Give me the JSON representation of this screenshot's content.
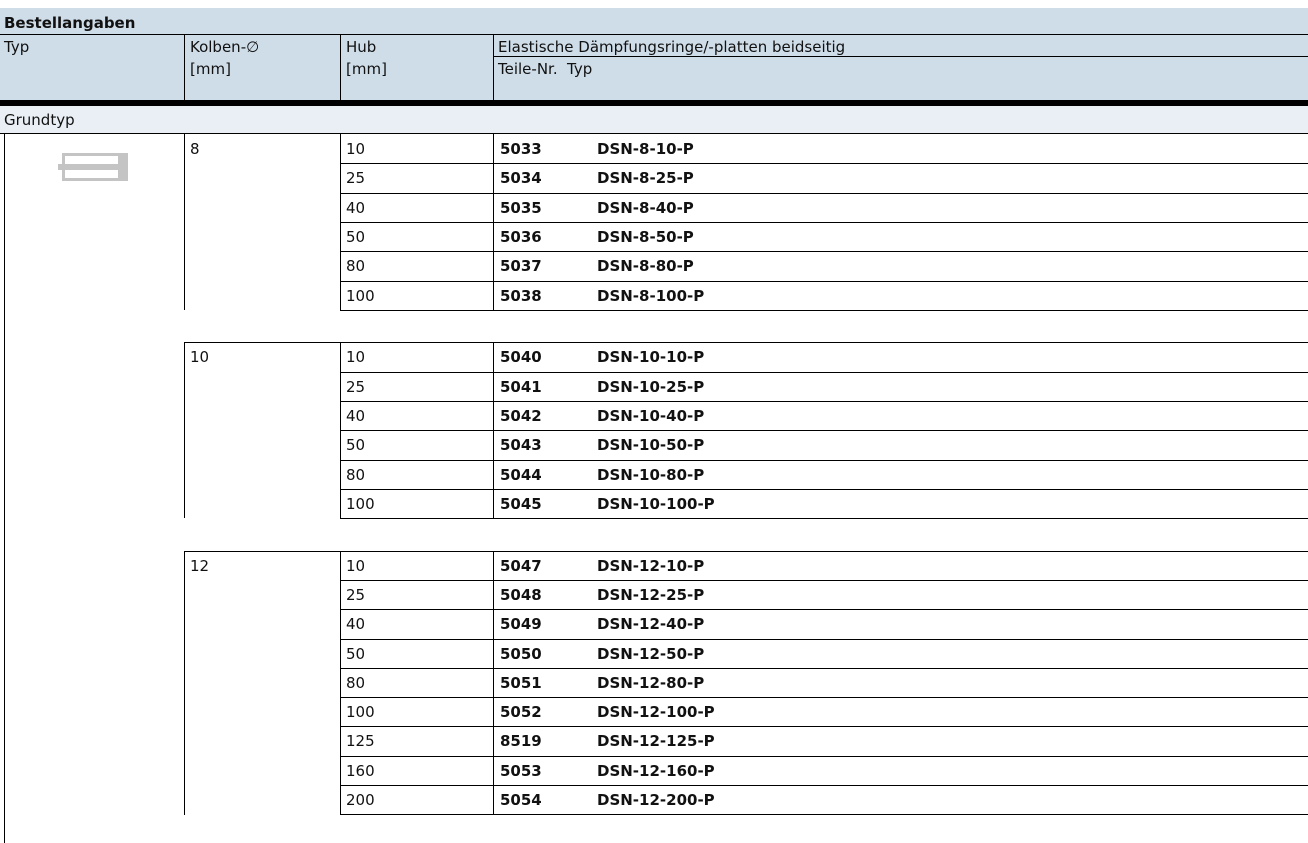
{
  "title": "Bestellangaben",
  "headers": {
    "typ": "Typ",
    "kolben": "Kolben-∅",
    "kolben_unit": "[mm]",
    "hub": "Hub",
    "hub_unit": "[mm]",
    "elastic": "Elastische Dämpfungsringe/-platten beidseitig",
    "teile_nr": "Teile-Nr.",
    "typ2": "Typ"
  },
  "section_label": "Grundtyp",
  "groups": [
    {
      "kolben": "8",
      "rows": [
        {
          "hub": "10",
          "part": "5033",
          "type": "DSN-8-10-P"
        },
        {
          "hub": "25",
          "part": "5034",
          "type": "DSN-8-25-P"
        },
        {
          "hub": "40",
          "part": "5035",
          "type": "DSN-8-40-P"
        },
        {
          "hub": "50",
          "part": "5036",
          "type": "DSN-8-50-P"
        },
        {
          "hub": "80",
          "part": "5037",
          "type": "DSN-8-80-P"
        },
        {
          "hub": "100",
          "part": "5038",
          "type": "DSN-8-100-P"
        }
      ]
    },
    {
      "kolben": "10",
      "rows": [
        {
          "hub": "10",
          "part": "5040",
          "type": "DSN-10-10-P"
        },
        {
          "hub": "25",
          "part": "5041",
          "type": "DSN-10-25-P"
        },
        {
          "hub": "40",
          "part": "5042",
          "type": "DSN-10-40-P"
        },
        {
          "hub": "50",
          "part": "5043",
          "type": "DSN-10-50-P"
        },
        {
          "hub": "80",
          "part": "5044",
          "type": "DSN-10-80-P"
        },
        {
          "hub": "100",
          "part": "5045",
          "type": "DSN-10-100-P"
        }
      ]
    },
    {
      "kolben": "12",
      "rows": [
        {
          "hub": "10",
          "part": "5047",
          "type": "DSN-12-10-P"
        },
        {
          "hub": "25",
          "part": "5048",
          "type": "DSN-12-25-P"
        },
        {
          "hub": "40",
          "part": "5049",
          "type": "DSN-12-40-P"
        },
        {
          "hub": "50",
          "part": "5050",
          "type": "DSN-12-50-P"
        },
        {
          "hub": "80",
          "part": "5051",
          "type": "DSN-12-80-P"
        },
        {
          "hub": "100",
          "part": "5052",
          "type": "DSN-12-100-P"
        },
        {
          "hub": "125",
          "part": "8519",
          "type": "DSN-12-125-P"
        },
        {
          "hub": "160",
          "part": "5053",
          "type": "DSN-12-160-P"
        },
        {
          "hub": "200",
          "part": "5054",
          "type": "DSN-12-200-P"
        }
      ]
    }
  ],
  "colors": {
    "header_bg": "#cfdde9",
    "section_bg": "#e9eff5",
    "rule": "#000000",
    "icon": "#c4c4c4"
  },
  "icons": {
    "product": "cylinder-icon"
  }
}
